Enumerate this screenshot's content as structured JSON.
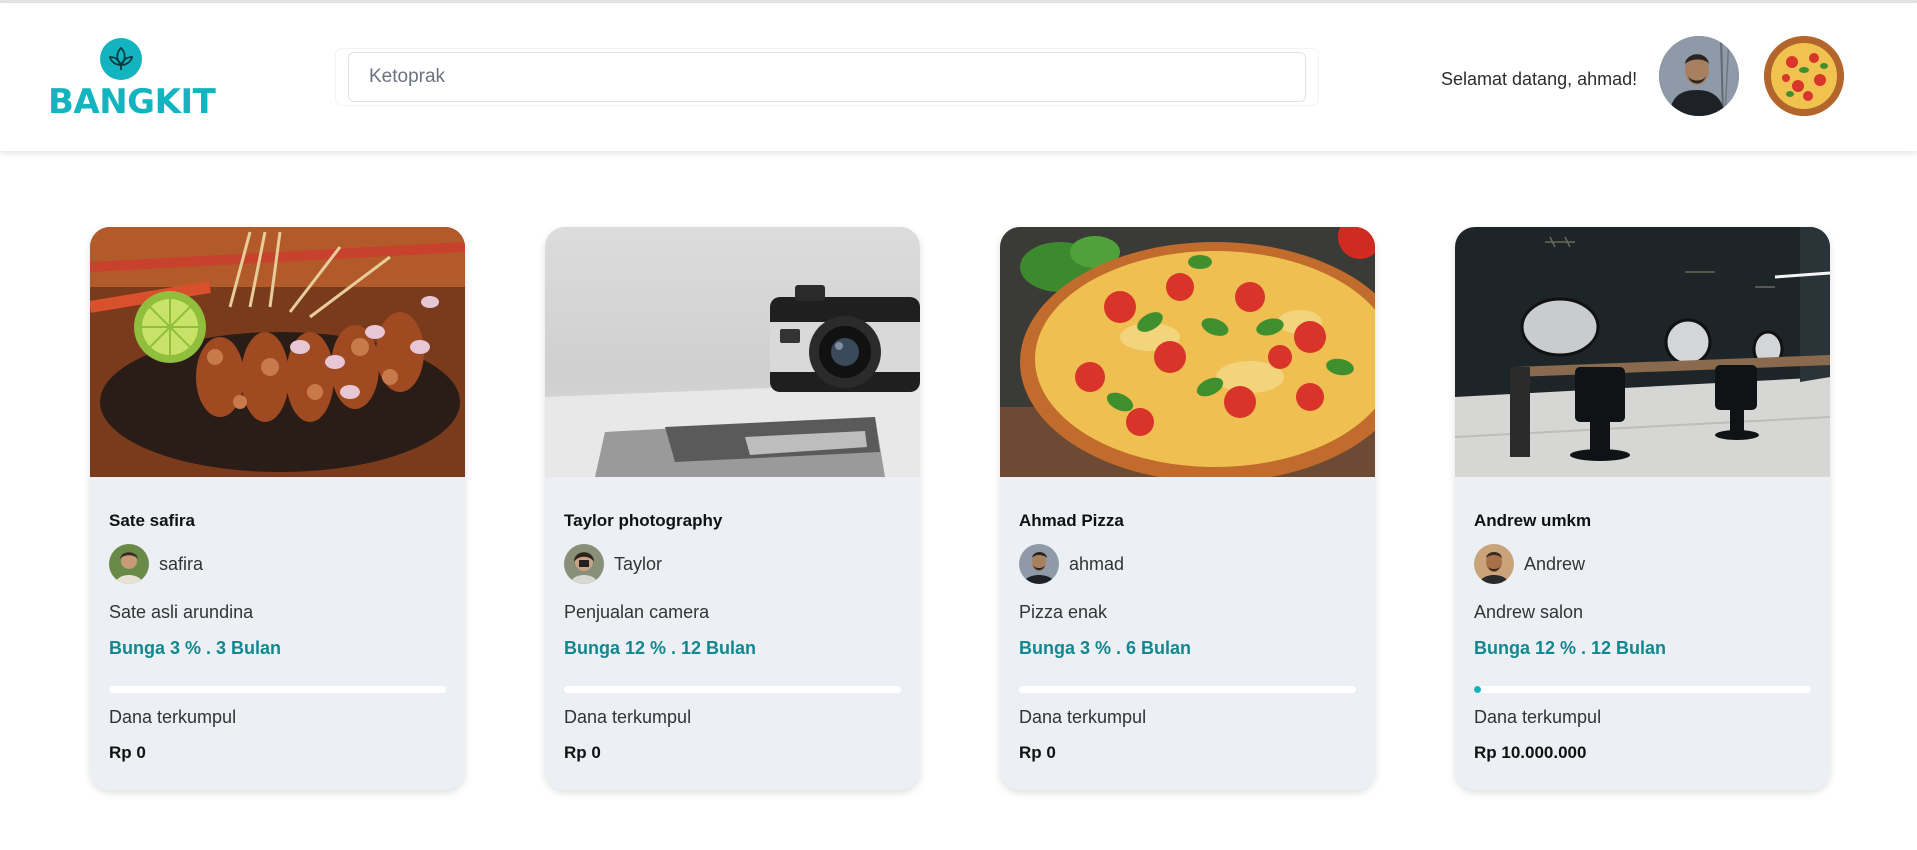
{
  "brand": {
    "name": "BANGKIT",
    "color": "#13b4bf",
    "icon": "leaf-logo-icon"
  },
  "search": {
    "placeholder": "Ketoprak"
  },
  "header": {
    "welcome": "Selamat datang, ahmad!",
    "user_avatar": "user-avatar",
    "business_avatar": "pizza-avatar"
  },
  "accent_text_color": "#12878f",
  "cards": [
    {
      "title": "Sate safira",
      "owner": "safira",
      "description": "Sate asli arundina",
      "terms": "Bunga 3 %  . 3 Bulan",
      "progress_fraction": 0.0,
      "fund_label": "Dana terkumpul",
      "fund_value": "Rp 0",
      "image": "satay-photo"
    },
    {
      "title": "Taylor photography",
      "owner": "Taylor",
      "description": "Penjualan camera",
      "terms": "Bunga 12 %  . 12 Bulan",
      "progress_fraction": 0.0,
      "fund_label": "Dana terkumpul",
      "fund_value": "Rp 0",
      "image": "camera-photo"
    },
    {
      "title": "Ahmad Pizza",
      "owner": "ahmad",
      "description": "Pizza enak",
      "terms": "Bunga 3 %  . 6 Bulan",
      "progress_fraction": 0.0,
      "fund_label": "Dana terkumpul",
      "fund_value": "Rp 0",
      "image": "pizza-photo"
    },
    {
      "title": "Andrew umkm",
      "owner": "Andrew",
      "description": "Andrew salon",
      "terms": "Bunga 12 %  . 12 Bulan",
      "progress_fraction": 0.02,
      "fund_label": "Dana terkumpul",
      "fund_value": "Rp 10.000.000",
      "image": "salon-photo"
    }
  ]
}
